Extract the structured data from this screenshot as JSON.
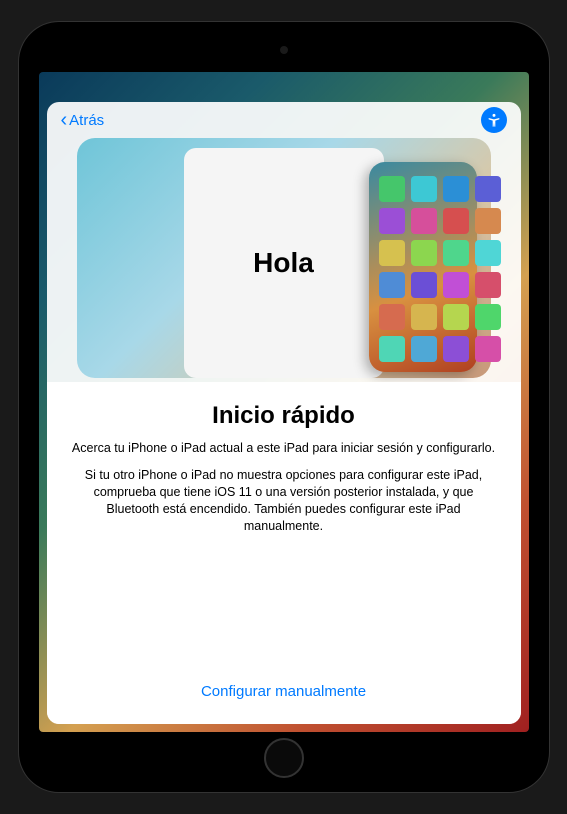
{
  "nav": {
    "back_label": "Atrás",
    "accessibility_icon": "accessibility-icon"
  },
  "hero": {
    "greeting": "Hola"
  },
  "sheet": {
    "title": "Inicio rápido",
    "description": "Acerca tu iPhone o iPad actual a este iPad para iniciar sesión y configurarlo.",
    "description2": "Si tu otro iPhone o iPad no muestra opciones para configurar este iPad, comprueba que tiene iOS 11 o una versión posterior instalada, y que Bluetooth está encendido. También puedes configurar este iPad manualmente.",
    "manual_link": "Configurar manualmente"
  },
  "colors": {
    "accent": "#007AFF"
  }
}
